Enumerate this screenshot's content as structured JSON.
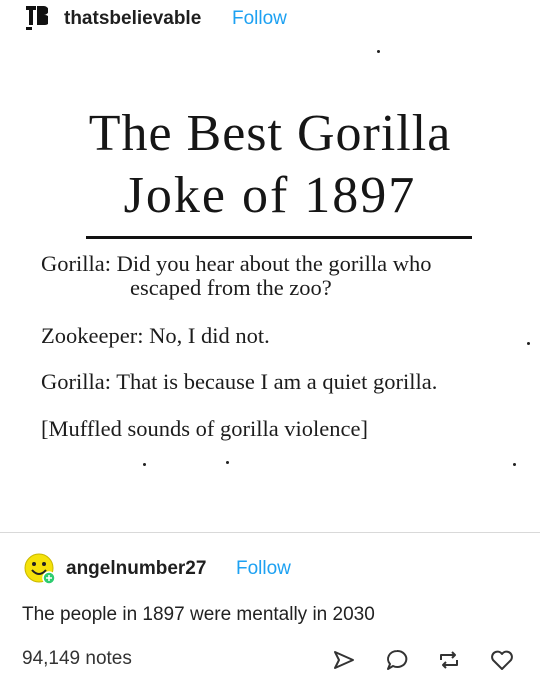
{
  "post": {
    "username": "thatsbelievable",
    "follow_label": "Follow",
    "logo_icon": "tb-logo-icon"
  },
  "scan": {
    "headline_line1": "The Best Gorilla",
    "headline_line2": "Joke of 1897",
    "lines": [
      "Gorilla: Did you hear about the gorilla who",
      "escaped from the zoo?",
      "Zookeeper: No, I did not.",
      "Gorilla: That is because I am a quiet gorilla.",
      "[Muffled sounds of gorilla violence]"
    ]
  },
  "reblog": {
    "username": "angelnumber27",
    "follow_label": "Follow",
    "comment": "The people in 1897 were mentally in 2030",
    "avatar_icon": "smiley-avatar-icon"
  },
  "footer": {
    "notes": "94,149 notes",
    "icons": [
      "share-icon",
      "reply-icon",
      "reblog-icon",
      "heart-icon"
    ]
  },
  "colors": {
    "follow": "#1da1f2",
    "text": "#1a1a1a",
    "avatar_yellow": "#f5e20a",
    "avatar_badge": "#2ecc71"
  }
}
